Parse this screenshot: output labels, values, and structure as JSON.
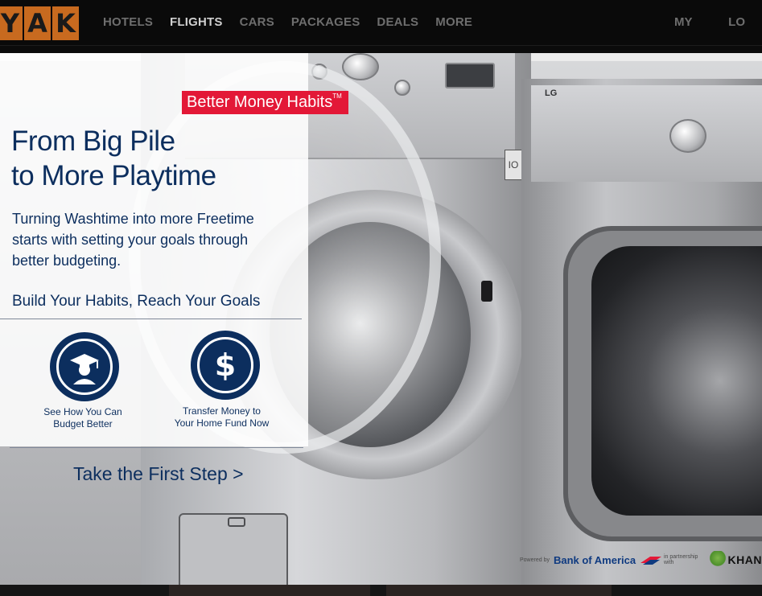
{
  "nav": {
    "logo_letters": [
      "Y",
      "A",
      "K"
    ],
    "items": [
      {
        "label": "HOTELS",
        "active": false
      },
      {
        "label": "FLIGHTS",
        "active": true
      },
      {
        "label": "CARS",
        "active": false
      },
      {
        "label": "PACKAGES",
        "active": false
      },
      {
        "label": "DEALS",
        "active": false
      },
      {
        "label": "MORE",
        "active": false
      }
    ],
    "right_items": [
      {
        "label": "MY TRIPS"
      },
      {
        "label": "LO"
      }
    ]
  },
  "ad": {
    "badge": "Better Money Habits",
    "badge_tm": "TM",
    "headline_line1": "From Big Pile",
    "headline_line2": "to More Playtime",
    "subtext_line1": "Turning Washtime into more Freetime",
    "subtext_line2": "starts with setting your goals through",
    "subtext_line3": "better budgeting.",
    "habits_heading": "Build Your Habits, Reach Your Goals",
    "actions": [
      {
        "icon": "graduate-icon",
        "line1": "See How You Can",
        "line2": "Budget Better"
      },
      {
        "icon": "dollar-icon",
        "line1": "Transfer Money to",
        "line2": "Your Home Fund Now"
      }
    ],
    "cta": "Take the First Step >",
    "powered_by": "Powered by",
    "bank": "Bank of America",
    "partnership": "in partnership with",
    "khan": "KHAN"
  },
  "washer": {
    "io_label": "IO",
    "brand": "LG"
  },
  "colors": {
    "navy": "#0c2e5e",
    "badge_red": "#e31837",
    "topbar": "#0a0a0a",
    "logo_orange": "#c86a1f"
  }
}
